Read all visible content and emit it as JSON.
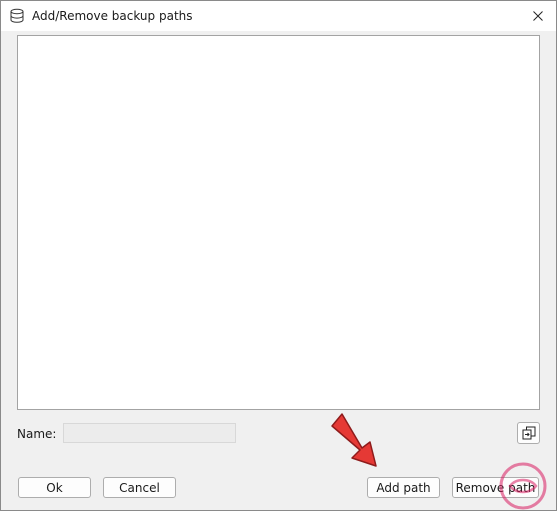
{
  "window": {
    "title": "Add/Remove backup paths",
    "title_icon": "database-icon",
    "close_icon": "close-icon"
  },
  "path_list": {
    "items": []
  },
  "name_field": {
    "label": "Name:",
    "value": "",
    "enabled": false
  },
  "copy_button": {
    "icon": "copy-icon"
  },
  "buttons": {
    "ok": "Ok",
    "cancel": "Cancel",
    "add_path": "Add path",
    "remove_path": "Remove path"
  },
  "annotation": {
    "arrow_color": "#e53935",
    "watermark_color": "#d81b60"
  }
}
